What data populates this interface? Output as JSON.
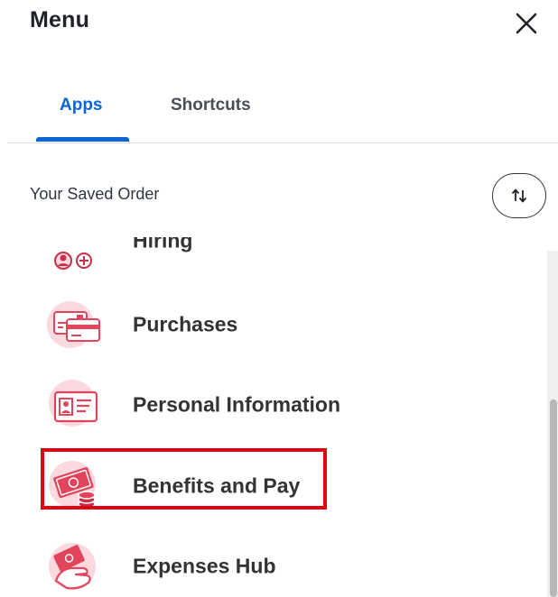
{
  "header": {
    "title": "Menu"
  },
  "tabs": [
    {
      "label": "Apps",
      "active": true
    },
    {
      "label": "Shortcuts",
      "active": false
    }
  ],
  "saved_order": {
    "label": "Your Saved Order"
  },
  "apps": [
    {
      "label": "Hiring",
      "icon": "hiring-icon",
      "partially_visible": true
    },
    {
      "label": "Purchases",
      "icon": "credit-cards-icon"
    },
    {
      "label": "Personal Information",
      "icon": "id-card-icon"
    },
    {
      "label": "Benefits and Pay",
      "icon": "money-coins-icon",
      "highlighted": true
    },
    {
      "label": "Expenses Hub",
      "icon": "hand-money-icon"
    }
  ],
  "colors": {
    "accent": "#0b65d4",
    "icon_primary": "#e2445c",
    "icon_circle": "#fbd9df",
    "highlight": "#e3000f"
  }
}
